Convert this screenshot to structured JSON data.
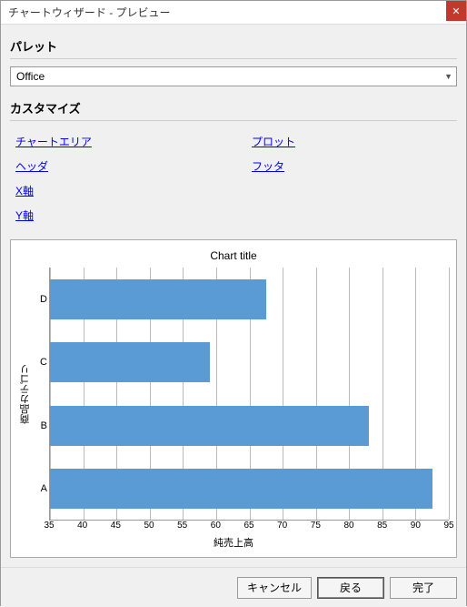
{
  "window": {
    "title": "チャートウィザード - プレビュー"
  },
  "palette": {
    "label": "パレット",
    "value": "Office"
  },
  "customize": {
    "label": "カスタマイズ",
    "links": {
      "chart_area": "チャートエリア",
      "plot": "プロット",
      "header": "ヘッダ",
      "footer": "フッタ",
      "x_axis": "X軸",
      "y_axis": "Y軸"
    }
  },
  "buttons": {
    "cancel": "キャンセル",
    "back": "戻る",
    "finish": "完了"
  },
  "chart_data": {
    "type": "bar",
    "orientation": "horizontal",
    "title": "Chart title",
    "xlabel": "純売上高",
    "ylabel": "商品カテゴリ",
    "xlim": [
      35,
      95
    ],
    "xticks": [
      35,
      40,
      45,
      50,
      55,
      60,
      65,
      70,
      75,
      80,
      85,
      90,
      95
    ],
    "categories": [
      "D",
      "C",
      "B",
      "A"
    ],
    "values": [
      67.5,
      59,
      83,
      92.5
    ]
  }
}
